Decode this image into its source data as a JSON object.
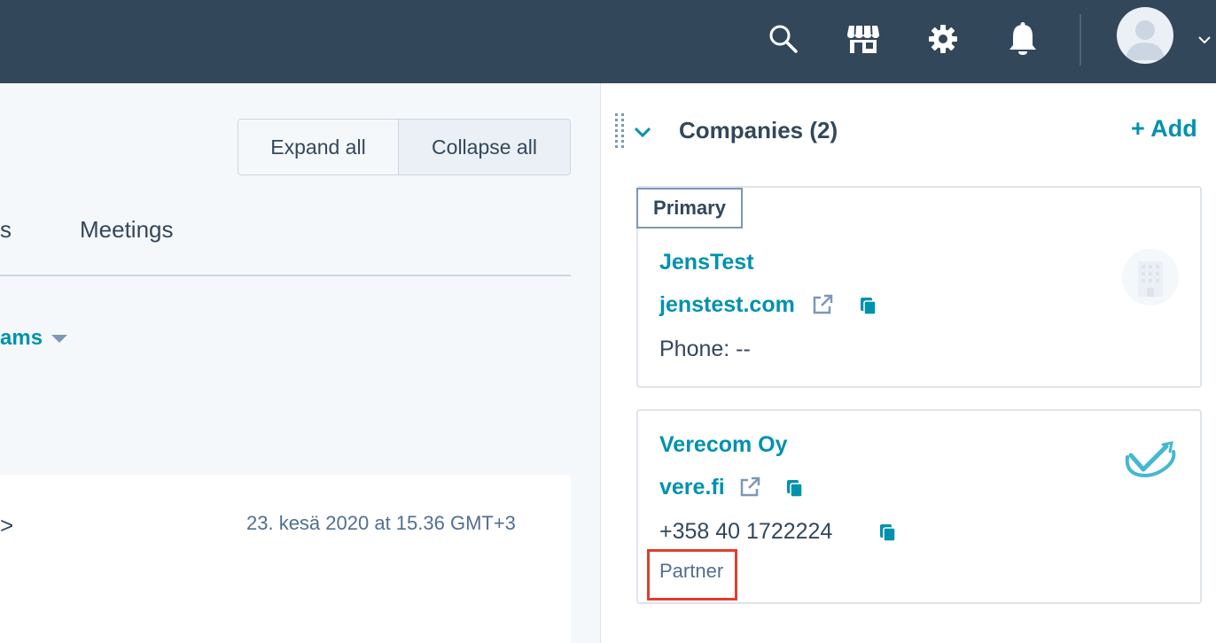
{
  "colors": {
    "nav_background": "#33475b",
    "link": "#0091ae",
    "text_primary": "#33475b",
    "text_secondary": "#516f90",
    "highlight_border": "#e03e2d"
  },
  "top_nav": {
    "icons": [
      "search-icon",
      "marketplace-icon",
      "settings-gear-icon",
      "notifications-bell-icon"
    ],
    "avatar": "user-avatar",
    "caret": "chevron-down-icon"
  },
  "toolbar": {
    "expand_all": "Expand all",
    "collapse_all": "Collapse all"
  },
  "tabs": {
    "partial_tab_end": "s",
    "meetings": "Meetings"
  },
  "filter": {
    "partial_label": "ams"
  },
  "activity": {
    "partial_arrow": ">",
    "timestamp": "23. kesä 2020 at 15.36 GMT+3"
  },
  "companies_section": {
    "title": "Companies (2)",
    "add_label": "+ Add",
    "companies": [
      {
        "badge": "Primary",
        "name": "JensTest",
        "domain": "jenstest.com",
        "phone": "Phone: --"
      },
      {
        "name": "Verecom Oy",
        "domain": "vere.fi",
        "phone": "+358 40 1722224",
        "tag": "Partner"
      }
    ]
  }
}
